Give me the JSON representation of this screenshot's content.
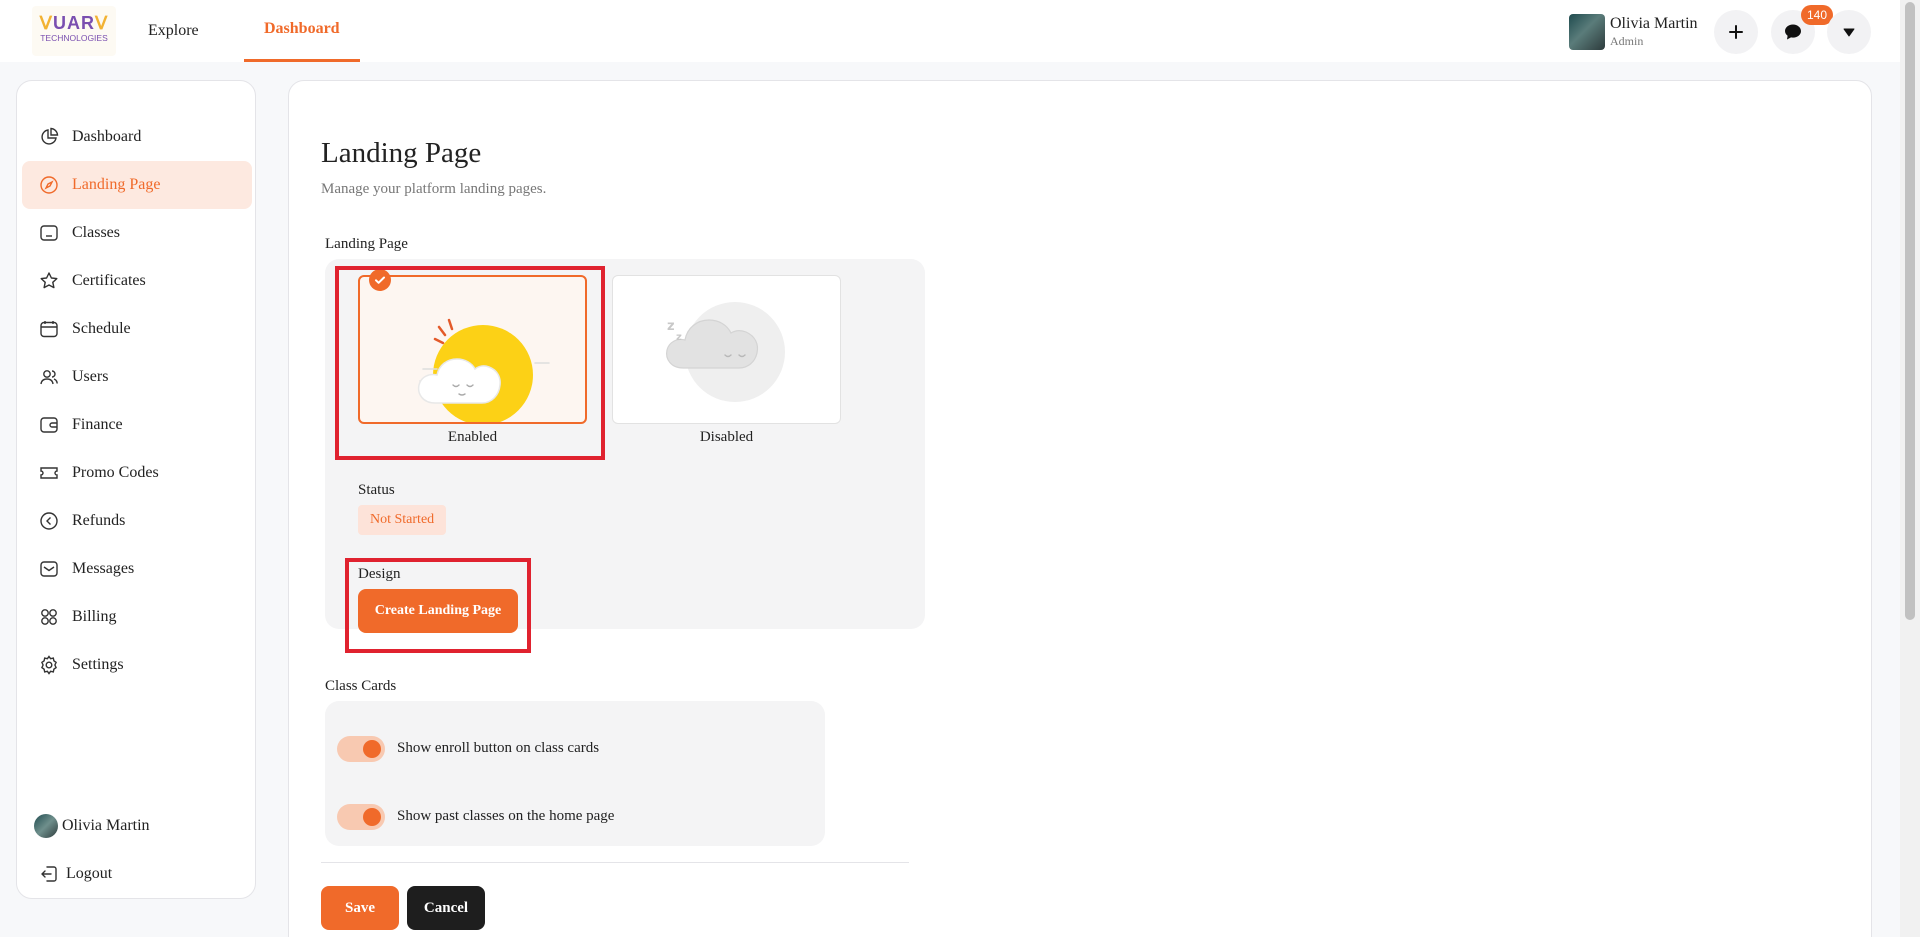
{
  "header": {
    "logo_top": "UAR",
    "logo_bottom": "TECHNOLOGIES",
    "nav": {
      "explore": "Explore",
      "dashboard": "Dashboard"
    },
    "user": {
      "name": "Olivia Martin",
      "role": "Admin"
    },
    "messages_count": "140",
    "icons": [
      "plus-icon",
      "chat-bubble-icon",
      "caret-down-icon"
    ]
  },
  "sidebar": {
    "items": [
      {
        "label": "Dashboard",
        "icon": "pie-chart-icon"
      },
      {
        "label": "Landing Page",
        "icon": "compass-icon",
        "active": true
      },
      {
        "label": "Classes",
        "icon": "folder-icon"
      },
      {
        "label": "Certificates",
        "icon": "star-icon"
      },
      {
        "label": "Schedule",
        "icon": "calendar-icon"
      },
      {
        "label": "Users",
        "icon": "users-icon"
      },
      {
        "label": "Finance",
        "icon": "wallet-icon"
      },
      {
        "label": "Promo Codes",
        "icon": "ticket-icon"
      },
      {
        "label": "Refunds",
        "icon": "chevron-left-circle-icon"
      },
      {
        "label": "Messages",
        "icon": "mail-icon"
      },
      {
        "label": "Billing",
        "icon": "grid-icon"
      },
      {
        "label": "Settings",
        "icon": "gear-icon"
      }
    ],
    "user_name": "Olivia Martin",
    "logout": "Logout"
  },
  "main": {
    "title": "Landing Page",
    "subtitle": "Manage your platform landing pages.",
    "landing_section_label": "Landing Page",
    "options": [
      {
        "label": "Enabled",
        "selected": true
      },
      {
        "label": "Disabled",
        "selected": false
      }
    ],
    "status_label": "Status",
    "status_value": "Not Started",
    "design_label": "Design",
    "create_button": "Create Landing Page",
    "class_cards_label": "Class Cards",
    "toggles": [
      {
        "label": "Show enroll button on class cards",
        "on": true
      },
      {
        "label": "Show past classes on the home page",
        "on": true
      }
    ],
    "save_button": "Save",
    "cancel_button": "Cancel"
  },
  "colors": {
    "accent": "#f06a2a",
    "accent_light": "#fde9e0",
    "highlight_outline": "#e0222f",
    "dark_button": "#1e1e1e"
  }
}
